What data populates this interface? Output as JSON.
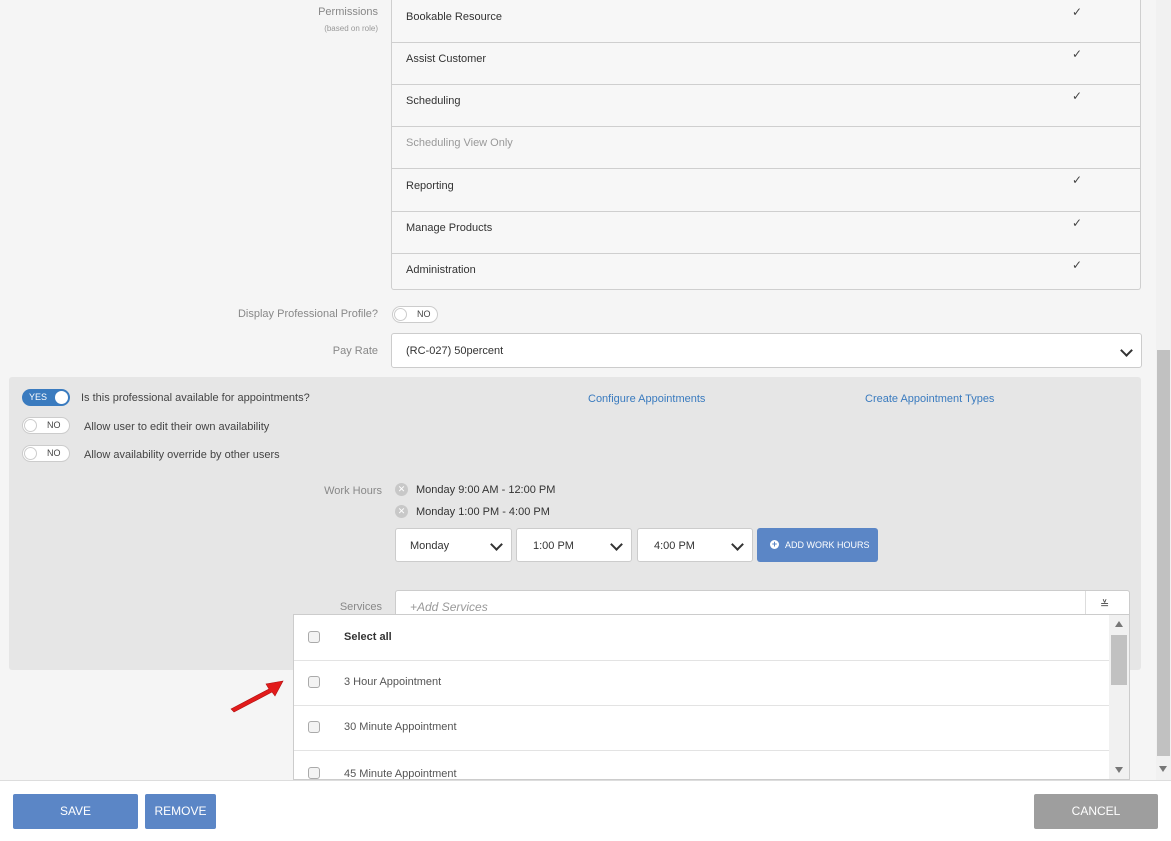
{
  "permissions": {
    "label": "Permissions",
    "sublabel": "(based on role)",
    "check_glyph": "✓",
    "items": [
      {
        "label": "Bookable Resource",
        "checked": true,
        "enabled": true
      },
      {
        "label": "Assist Customer",
        "checked": true,
        "enabled": true
      },
      {
        "label": "Scheduling",
        "checked": true,
        "enabled": true
      },
      {
        "label": "Scheduling View Only",
        "checked": false,
        "enabled": false
      },
      {
        "label": "Reporting",
        "checked": true,
        "enabled": true
      },
      {
        "label": "Manage Products",
        "checked": true,
        "enabled": true
      },
      {
        "label": "Administration",
        "checked": true,
        "enabled": true
      }
    ]
  },
  "profile": {
    "label": "Display Professional Profile?",
    "toggle": "NO"
  },
  "pay_rate": {
    "label": "Pay Rate",
    "value": "(RC-027) 50percent"
  },
  "availability": {
    "available": {
      "toggle": "YES",
      "label": "Is this professional available for appointments?"
    },
    "edit_own": {
      "toggle": "NO",
      "label": "Allow user to edit their own availability"
    },
    "override": {
      "toggle": "NO",
      "label": "Allow availability override by other users"
    },
    "configure_link": "Configure Appointments",
    "create_types_link": "Create Appointment Types"
  },
  "work_hours": {
    "label": "Work Hours",
    "entries": [
      "Monday 9:00 AM - 12:00 PM",
      "Monday 1:00 PM - 4:00 PM"
    ],
    "day": "Monday",
    "start": "1:00 PM",
    "end": "4:00 PM",
    "add_button": "ADD WORK HOURS"
  },
  "services": {
    "label": "Services",
    "placeholder": "+Add Services",
    "options": [
      "Select all",
      "3 Hour Appointment",
      "30 Minute Appointment",
      "45 Minute Appointment"
    ]
  },
  "footer": {
    "save": "SAVE",
    "remove": "REMOVE",
    "cancel": "CANCEL"
  },
  "colors": {
    "primary": "#5b86c6",
    "toggle_on": "#3a7bbf",
    "cancel": "#9e9e9e",
    "arrow": "#e21b1b"
  }
}
